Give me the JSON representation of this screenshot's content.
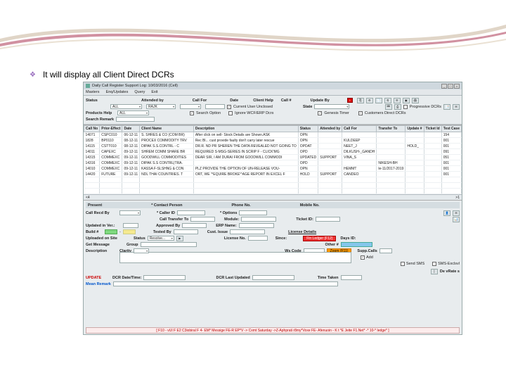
{
  "slide": {
    "bullet_text": "It will display all Client Direct DCRs"
  },
  "window": {
    "title": "Daily Call Register Support Log: 10/03/2016 (Cell)",
    "menu": [
      "Masters",
      "Enq/Updates",
      "Query",
      "Exit"
    ]
  },
  "filters": {
    "status_label": "Status",
    "attended_by_label": "Attended by",
    "call_for_label": "Call For",
    "date_label": "Date",
    "client_help_label": "Client Help",
    "call_no_label": "Call #",
    "update_by_label": "Update By",
    "state_label": "State",
    "products_help_label": "Products Help",
    "search_remark_label": "Search Remark",
    "all_value": "ALL",
    "rajk_value": "RAJK",
    "current_user_label": "Current User Unclosed",
    "search_option_label": "Search Option",
    "ignore_label": "Ignore WCF/ERP Dcrs",
    "genesis_timer_label": "Genesis Timer",
    "customers_direct_label": "Customers Direct DCRs",
    "progressive_label": "Progressive DCRs",
    "red_num": "1"
  },
  "table": {
    "headers": [
      "Call No",
      "Prior-Effect",
      "Date",
      "Client Name",
      "Description",
      "Status",
      "Attended by",
      "Call For",
      "Transfer To",
      "Update #",
      "Ticket Id",
      "Test Case"
    ],
    "rows": [
      [
        "14071",
        "CSPC010",
        "06-12-11",
        "S. SHRES & CO (COM BR)",
        "After click on sell- Stock Details are Shown.ASK",
        "OPN",
        "",
        "",
        "",
        "",
        "",
        "154"
      ],
      [
        "1828",
        "BP0110",
        "08-12-11",
        "PROCEX COMMODITY TRV",
        "Rec Bl... cust provide faulty don't carry later rescue",
        "OPN",
        "",
        "KULDEEP",
        "",
        "",
        "",
        "001"
      ],
      [
        "14115",
        "CSTT010",
        "08-12-11",
        "DIPAK S.S.CONTRL - C",
        "DR.R. ND PR SHEREN THE DATA REVEALED NOT GOING TO",
        "OPDAT",
        "",
        "NEET_J",
        "",
        "HOLD_",
        "",
        "001"
      ],
      [
        "14011",
        "CAPEXC",
        "09-12-11",
        "SHREM COMM SHARE BR",
        "REQUIRED S-MSG-SERIES IN SCRIP F - CLICK'MG",
        "OPD",
        "",
        "DILKUSH-_GANDH",
        "",
        "",
        "",
        "091"
      ],
      [
        "14315",
        "COMMEXC",
        "09-12-11",
        "GOODWILL COMMODITIES",
        "DEAR SIR, I AM DURAI FROM GOODWILL COMMODI",
        "UPDATED",
        "SUPPORT",
        "VINA_S",
        "",
        "",
        "",
        "051"
      ],
      [
        "14316",
        "COMMEXC",
        "09-12-11",
        "DIPAK S.S CONTRL|TRA.",
        "",
        "OPD",
        "",
        "",
        "NIKESH-BH",
        "",
        "",
        "001"
      ],
      [
        "14010",
        "COMMEXC",
        "09-12-11",
        "KASSA F-SLSHNG & CON",
        "PLZ PROVIDE THE OPTION OF UN-RELEASE VOU-",
        "OPN",
        "",
        "HEMMT",
        "le-11/2017-2019",
        "",
        "",
        "001"
      ],
      [
        "14420",
        "FUTURE",
        "09-12-11",
        "NDL THAI COUNTRIES. T",
        "ORT, WE '^EQUIRE BROKE'^AGE REPORT IN EXCEL F",
        "HOLD",
        "SUPPORT",
        "CANDEO",
        "",
        "",
        "",
        "001"
      ]
    ],
    "foot_left": "<4",
    "foot_right": ">1"
  },
  "section2": {
    "present_label": "Present",
    "contact_person_label": "* Contact Person",
    "phone_label": "Phone No.",
    "mobile_label": "Mobile No.",
    "call_recd_by_label": "Call Recd By",
    "caller_id_label": "* Caller ID",
    "options_label": "* Options",
    "call_transfer_label": "Call Transfer To",
    "module_label": "Module:",
    "ticket_id_label": "Ticket ID:",
    "updated_ver_label": "Updated in Ver.:",
    "approved_by_label": "Approved By",
    "erp_name_label": "ERP Name:",
    "build_label": "Build #",
    "build_dash": "-",
    "tested_by_label": "Tested By",
    "cust_issue_label": "Cust. Issue",
    "uploaded_label": "Uploaded on Site",
    "status_label": "Status",
    "license_details_label": "License Details",
    "license_no_label": "License No.",
    "since_label": "Since:",
    "fin_ledger_label": "Fin Ledger (F12)",
    "days_label": "Days ID:",
    "get_group_label": "Get Message",
    "group_label": "Group",
    "other_label": "Other #",
    "description_label": "Description",
    "clarity_label": "Clarity",
    "ws_code_label": "Ws Code",
    "zoom_label": "Zoom (F11)",
    "supp_call_label": "Supp.Calls",
    "add_label": "Add",
    "send_sms_label": "Send SMS",
    "sms_excl_label": "SMS-Exclsvl",
    "update_label": "UPDATE",
    "dcr_dt_label": "DCR Date/Time:",
    "dcr_last_label": "DCR Last Updated",
    "time_taken_label": "Time Taken",
    "mean_remark_label": "Mean Remark",
    "dev_label": "De vRate s",
    "resolve_placeholder": "Resolve ..."
  },
  "bottom_help": "[ F10 - vUI F E2 C3iobiral F 4- EM* Messige   FE-R EP*V -> Cxmt Saturday ->Z-Aphprati r8my*Voxe   FE- Afenuoin - K t *E Jeite   F1.Net* -* 10-* Iedge* ]"
}
